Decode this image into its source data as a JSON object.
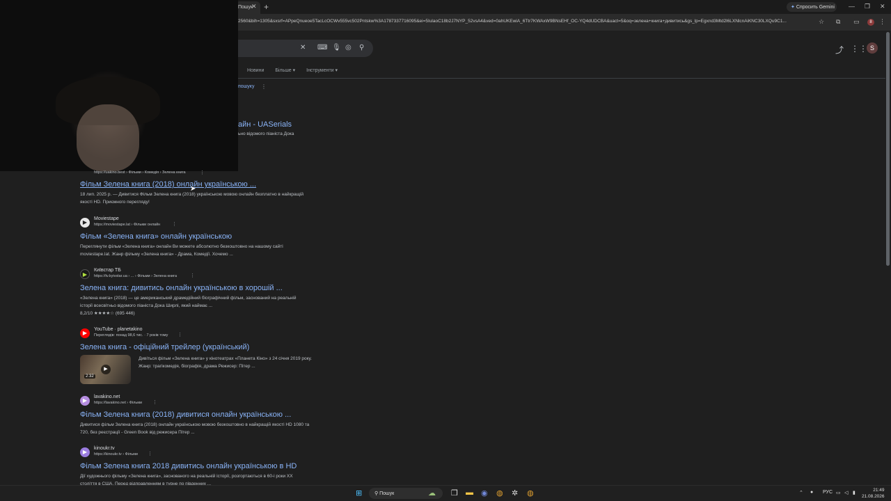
{
  "browser": {
    "tab_title": "Пошук",
    "gemini_label": "Спросить Gemini",
    "url": "2560&bih=1305&sxsrf=APpeQnueoe5TacLcOCWv555vc502Pntskw%3A1787337716095&ei=5IulaoC18b2J7NYP_52vsA4&ved=0ahUKEwiA_6Ttr7KWAxW9BNsEHf_OC-YQ4dUDCBA&uact=5&oq=зелена+книга+дивитись&gs_lp=Egxnd3Mtd2l6LXNlcnAiKNC30LXQu9C1...",
    "profile_initial": "8"
  },
  "header": {
    "account_initial": "S",
    "filters": [
      "Новини",
      "Більше ▾",
      "Інструменти ▾"
    ],
    "help_link": "пошуку"
  },
  "top_result": {
    "title": "айн - UASerials",
    "snippet": "ьно відомого піаніста Дока"
  },
  "results": [
    {
      "site_name": "",
      "site_url": "https://uakino.best › Фільми › Комедія › Зелена книга",
      "title": "Фільм Зелена книга (2018) онлайн українською ...",
      "snippet": "18 лип. 2025 р. — Дивитися Фільм Зелена книга (2018) українською мовою онлайн безплатно в найкращій якості HD. Приємного перегляду!"
    },
    {
      "site_name": "Moviestape",
      "site_url": "https://moviestape.lat › Фільми онлайн",
      "title": "Фільм «Зелена книга» онлайн українською",
      "snippet": "Переглянути фільм «Зелена книга» онлайн Ви можете абсолютно безкоштовно на нашому сайті moviestape.lat. Жанр фільму «Зелена книга» - Драма, Комедії. Хочемо ..."
    },
    {
      "site_name": "Київстар ТБ",
      "site_url": "https://tv.kyivstar.ua › ... › Фільми › Зелена книга",
      "title": "Зелена книга: дивитись онлайн українською в хорошій ...",
      "snippet": "«Зелена книга» (2018) — це американський драмедійний біографічний фільм, заснований на реальній історії всесвітньо відомого піаніста Дока Ширлі, який наймає ...",
      "rating_text": "8,2/10 ★★★★☆ (695 446)"
    },
    {
      "site_name": "YouTube · planetakino",
      "site_url": "Переглядів: понад 98,6 тис. · 7 років тому",
      "title": "Зелена книга - офіційний трейлер (український)",
      "snippet": "Дивіться фільм «Зелена книга» у кінотеатрах «Планета Кіно» з 24 січня 2019 року. Жанр: трагікомедія, біографія, драма Режисер: Пітер ...",
      "duration": "2:32"
    },
    {
      "site_name": "lavakino.net",
      "site_url": "https://lavakino.net › Фільми",
      "title": "Фільм Зелена книга (2018) дивитися онлайн українською ...",
      "snippet": "Дивитися фільм Зелена книга (2018) онлайн українською мовою безкоштовно в найкращій якості HD 1080 та 720, без реєстрації - Green Book від режисера Пітер ..."
    },
    {
      "site_name": "kinoukr.tv",
      "site_url": "https://kinoukr.tv › Фільми",
      "title": "Фільм Зелена книга 2018 дивитись онлайн українською в HD",
      "snippet": "Дії художнього фільму «Зелена книга», заснованого на реальній історії, розгортаються в 60-і роки XX століття в США. Перед відправленням в турне по південних ..."
    }
  ],
  "taskbar": {
    "search_label": "Пошук",
    "lang": "РУС",
    "time": "21:49",
    "date": "21.08.2026"
  }
}
